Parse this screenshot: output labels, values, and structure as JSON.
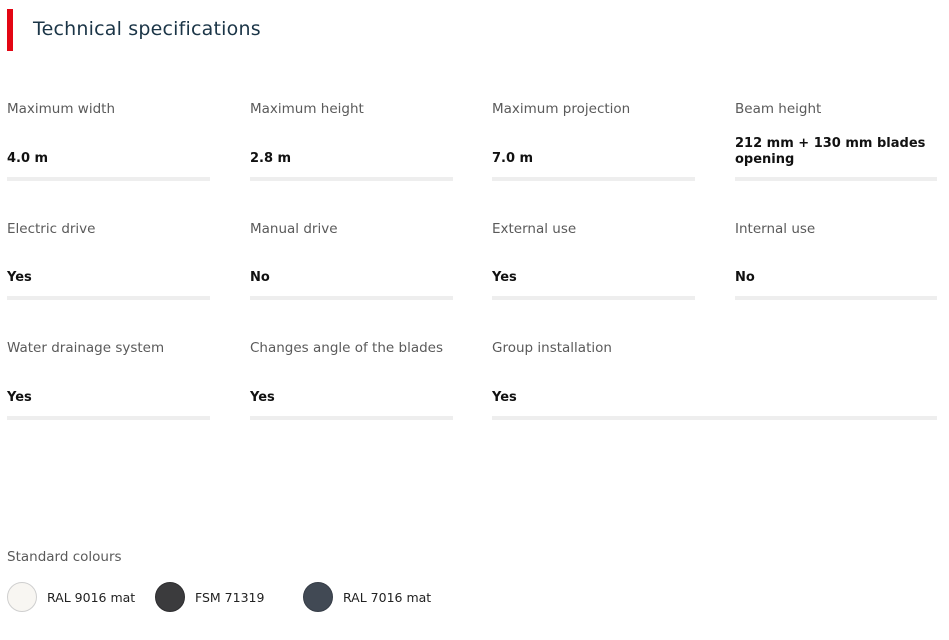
{
  "section": {
    "title": "Technical specifications"
  },
  "specs": [
    {
      "label": "Maximum width",
      "value": "4.0 m"
    },
    {
      "label": "Maximum height",
      "value": "2.8 m"
    },
    {
      "label": "Maximum projection",
      "value": "7.0 m"
    },
    {
      "label": "Beam height",
      "value": "212 mm + 130 mm blades opening"
    },
    {
      "label": "Electric drive",
      "value": "Yes"
    },
    {
      "label": "Manual drive",
      "value": "No"
    },
    {
      "label": "External use",
      "value": "Yes"
    },
    {
      "label": "Internal use",
      "value": "No"
    },
    {
      "label": "Water drainage system",
      "value": "Yes"
    },
    {
      "label": "Changes angle of the blades",
      "value": "Yes"
    },
    {
      "label": "Group installation",
      "value": "Yes"
    }
  ],
  "colours": {
    "label": "Standard colours",
    "items": [
      {
        "name": "RAL 9016 mat",
        "color": "#f8f6f2"
      },
      {
        "name": "FSM 71319",
        "color": "#3b3b3d"
      },
      {
        "name": "RAL 7016 mat",
        "color": "#414954"
      }
    ]
  },
  "theme": {
    "accent": "#e30613",
    "title_color": "#1b3547",
    "divider": "#eeeeee"
  }
}
